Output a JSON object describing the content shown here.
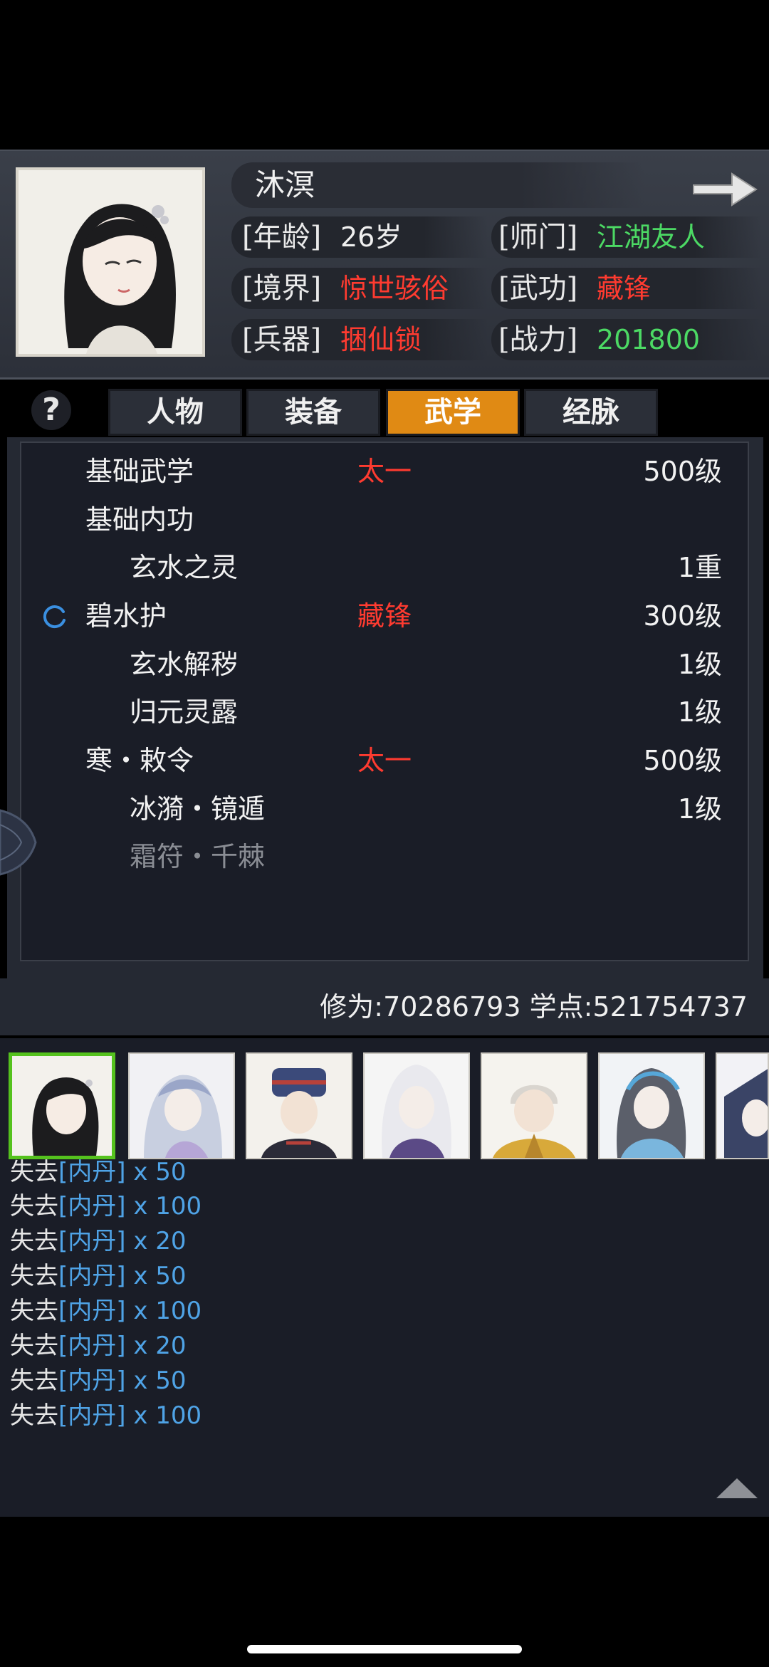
{
  "character": {
    "name": "沐溟",
    "stats": [
      {
        "label": "[年龄]",
        "value": "26岁",
        "color": "white"
      },
      {
        "label": "[师门]",
        "value": "江湖友人",
        "color": "green"
      },
      {
        "label": "[境界]",
        "value": "惊世骇俗",
        "color": "red"
      },
      {
        "label": "[武功]",
        "value": "藏锋",
        "color": "red"
      },
      {
        "label": "[兵器]",
        "value": "捆仙锁",
        "color": "red"
      },
      {
        "label": "[战力]",
        "value": "201800",
        "color": "green"
      }
    ]
  },
  "tabs": [
    {
      "label": "人物",
      "active": false
    },
    {
      "label": "装备",
      "active": false
    },
    {
      "label": "武学",
      "active": true
    },
    {
      "label": "经脉",
      "active": false
    }
  ],
  "help_label": "?",
  "skills": [
    {
      "name": "基础武学",
      "school": "太一",
      "level": "500级",
      "indent": false,
      "dim": false,
      "loading": false
    },
    {
      "name": "基础内功",
      "school": "",
      "level": "",
      "indent": false,
      "dim": false,
      "loading": false
    },
    {
      "name": "玄水之灵",
      "school": "",
      "level": "1重",
      "indent": true,
      "dim": false,
      "loading": false
    },
    {
      "name": "碧水护",
      "school": "藏锋",
      "level": "300级",
      "indent": false,
      "dim": false,
      "loading": true
    },
    {
      "name": "玄水解秽",
      "school": "",
      "level": "1级",
      "indent": true,
      "dim": false,
      "loading": false
    },
    {
      "name": "归元灵露",
      "school": "",
      "level": "1级",
      "indent": true,
      "dim": false,
      "loading": false
    },
    {
      "name": "寒・敕令",
      "school": "太一",
      "level": "500级",
      "indent": false,
      "dim": false,
      "loading": false
    },
    {
      "name": "冰漪・镜遁",
      "school": "",
      "level": "1级",
      "indent": true,
      "dim": false,
      "loading": false
    },
    {
      "name": "霜符・千棘",
      "school": "",
      "level": "",
      "indent": true,
      "dim": true,
      "loading": false
    }
  ],
  "points": {
    "text": "修为:70286793  学点:521754737"
  },
  "roster": [
    {
      "name": "avatar-1",
      "selected": true
    },
    {
      "name": "avatar-2",
      "selected": false
    },
    {
      "name": "avatar-3",
      "selected": false
    },
    {
      "name": "avatar-4",
      "selected": false
    },
    {
      "name": "avatar-5",
      "selected": false
    },
    {
      "name": "avatar-6",
      "selected": false
    },
    {
      "name": "avatar-7",
      "selected": false
    }
  ],
  "log": [
    {
      "prefix": "失去",
      "item": "[内丹]",
      "suffix": " x 50"
    },
    {
      "prefix": "失去",
      "item": "[内丹]",
      "suffix": " x 100"
    },
    {
      "prefix": "失去",
      "item": "[内丹]",
      "suffix": " x 20"
    },
    {
      "prefix": "失去",
      "item": "[内丹]",
      "suffix": " x 50"
    },
    {
      "prefix": "失去",
      "item": "[内丹]",
      "suffix": " x 100"
    },
    {
      "prefix": "失去",
      "item": "[内丹]",
      "suffix": " x 20"
    },
    {
      "prefix": "失去",
      "item": "[内丹]",
      "suffix": " x 50"
    },
    {
      "prefix": "失去",
      "item": "[内丹]",
      "suffix": " x 100"
    }
  ],
  "icons": {
    "next": "arrow-right-icon",
    "scroll_up": "triangle-up-icon",
    "loading": "spinner-icon"
  }
}
